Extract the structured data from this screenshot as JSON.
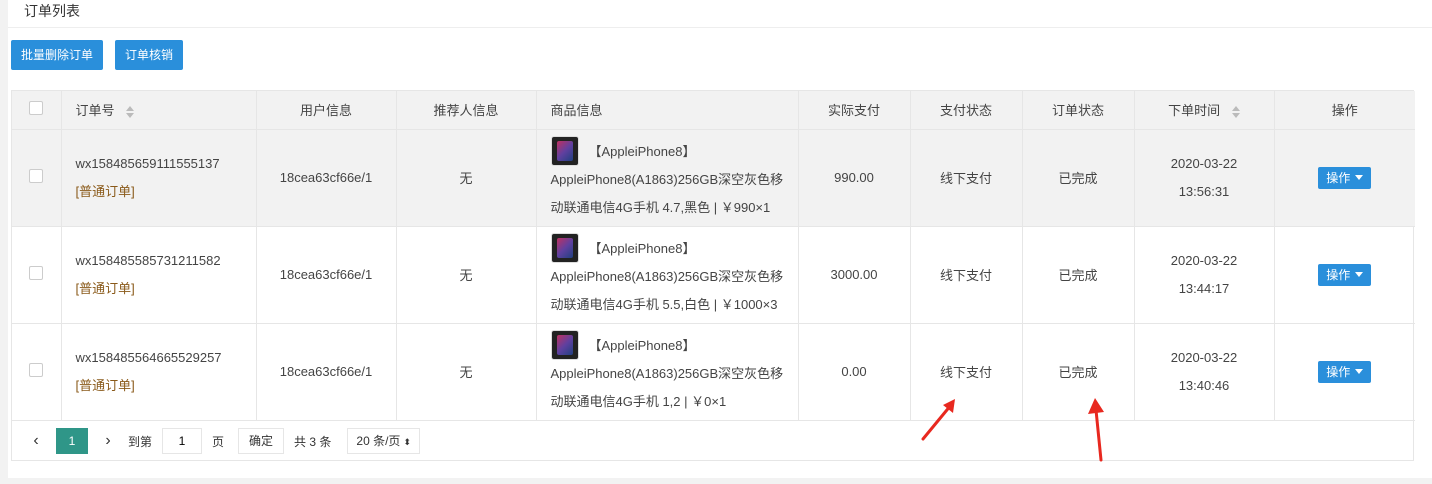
{
  "panel": {
    "title": "订单列表"
  },
  "toolbar": {
    "batch_delete": "批量删除订单",
    "verify": "订单核销"
  },
  "table": {
    "headers": {
      "order_no": "订单号",
      "user": "用户信息",
      "referrer": "推荐人信息",
      "goods": "商品信息",
      "paid": "实际支付",
      "pay_status": "支付状态",
      "order_status": "订单状态",
      "time": "下单时间",
      "actions": "操作"
    },
    "rows": [
      {
        "order_no": "wx158485659111555137",
        "order_type": "[普通订单]",
        "user": "18cea63cf66e/1",
        "referrer": "无",
        "goods_title": "【AppleiPhone8】",
        "goods_line1": "AppleiPhone8(A1863)256GB深空灰色移",
        "goods_line2": "动联通电信4G手机 4.7,黑色 | ￥990×1",
        "paid": "990.00",
        "pay_status": "线下支付",
        "order_status": "已完成",
        "date": "2020-03-22",
        "clock": "13:56:31",
        "action": "操作"
      },
      {
        "order_no": "wx158485585731211582",
        "order_type": "[普通订单]",
        "user": "18cea63cf66e/1",
        "referrer": "无",
        "goods_title": "【AppleiPhone8】",
        "goods_line1": "AppleiPhone8(A1863)256GB深空灰色移",
        "goods_line2": "动联通电信4G手机 5.5,白色 | ￥1000×3",
        "paid": "3000.00",
        "pay_status": "线下支付",
        "order_status": "已完成",
        "date": "2020-03-22",
        "clock": "13:44:17",
        "action": "操作"
      },
      {
        "order_no": "wx158485564665529257",
        "order_type": "[普通订单]",
        "user": "18cea63cf66e/1",
        "referrer": "无",
        "goods_title": "【AppleiPhone8】",
        "goods_line1": "AppleiPhone8(A1863)256GB深空灰色移",
        "goods_line2": "动联通电信4G手机 1,2 | ￥0×1",
        "paid": "0.00",
        "pay_status": "线下支付",
        "order_status": "已完成",
        "date": "2020-03-22",
        "clock": "13:40:46",
        "action": "操作"
      }
    ]
  },
  "pager": {
    "current": "1",
    "goto_label": "到第",
    "goto_value": "1",
    "page_label": "页",
    "confirm": "确定",
    "total": "共 3 条",
    "page_size": "20 条/页"
  },
  "colors": {
    "primary": "#2a8fdb",
    "page_active": "#2f9688",
    "annotation": "#e8281f"
  }
}
